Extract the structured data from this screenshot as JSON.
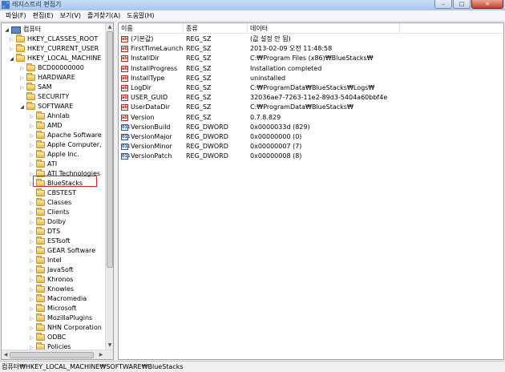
{
  "window": {
    "title": "레지스트리 편집기",
    "controls": {
      "minimize": "–",
      "maximize": "□",
      "close": "✕"
    }
  },
  "menu": [
    "파일(F)",
    "편집(E)",
    "보기(V)",
    "즐겨찾기(A)",
    "도움말(H)"
  ],
  "tree": {
    "items": [
      {
        "label": "컴퓨터",
        "level": 0,
        "expander": "open",
        "icon": "computer-icon"
      },
      {
        "label": "HKEY_CLASSES_ROOT",
        "level": 1,
        "expander": "closed",
        "icon": "folder-icon"
      },
      {
        "label": "HKEY_CURRENT_USER",
        "level": 1,
        "expander": "closed",
        "icon": "folder-icon"
      },
      {
        "label": "HKEY_LOCAL_MACHINE",
        "level": 1,
        "expander": "open",
        "icon": "folder-icon"
      },
      {
        "label": "BCD00000000",
        "level": 2,
        "expander": "closed",
        "icon": "folder-icon"
      },
      {
        "label": "HARDWARE",
        "level": 2,
        "expander": "closed",
        "icon": "folder-icon"
      },
      {
        "label": "SAM",
        "level": 2,
        "expander": "closed",
        "icon": "folder-icon"
      },
      {
        "label": "SECURITY",
        "level": 2,
        "expander": "none",
        "icon": "folder-icon"
      },
      {
        "label": "SOFTWARE",
        "level": 2,
        "expander": "open",
        "icon": "folder-icon"
      },
      {
        "label": "Ahnlab",
        "level": 3,
        "expander": "closed",
        "icon": "folder-icon"
      },
      {
        "label": "AMD",
        "level": 3,
        "expander": "closed",
        "icon": "folder-icon"
      },
      {
        "label": "Apache Software",
        "level": 3,
        "expander": "closed",
        "icon": "folder-icon"
      },
      {
        "label": "Apple Computer,",
        "level": 3,
        "expander": "closed",
        "icon": "folder-icon"
      },
      {
        "label": "Apple Inc.",
        "level": 3,
        "expander": "closed",
        "icon": "folder-icon"
      },
      {
        "label": "ATI",
        "level": 3,
        "expander": "closed",
        "icon": "folder-icon"
      },
      {
        "label": "ATI Technologies",
        "level": 3,
        "expander": "closed",
        "icon": "folder-icon"
      },
      {
        "label": "BlueStacks",
        "level": 3,
        "expander": "closed",
        "icon": "folder-icon",
        "selected": true
      },
      {
        "label": "CBSTEST",
        "level": 3,
        "expander": "none",
        "icon": "folder-icon"
      },
      {
        "label": "Classes",
        "level": 3,
        "expander": "closed",
        "icon": "folder-icon"
      },
      {
        "label": "Clients",
        "level": 3,
        "expander": "closed",
        "icon": "folder-icon"
      },
      {
        "label": "Dolby",
        "level": 3,
        "expander": "closed",
        "icon": "folder-icon"
      },
      {
        "label": "DTS",
        "level": 3,
        "expander": "closed",
        "icon": "folder-icon"
      },
      {
        "label": "ESTsoft",
        "level": 3,
        "expander": "closed",
        "icon": "folder-icon"
      },
      {
        "label": "GEAR Software",
        "level": 3,
        "expander": "closed",
        "icon": "folder-icon"
      },
      {
        "label": "Intel",
        "level": 3,
        "expander": "closed",
        "icon": "folder-icon"
      },
      {
        "label": "JavaSoft",
        "level": 3,
        "expander": "closed",
        "icon": "folder-icon"
      },
      {
        "label": "Khronos",
        "level": 3,
        "expander": "closed",
        "icon": "folder-icon"
      },
      {
        "label": "Knowles",
        "level": 3,
        "expander": "closed",
        "icon": "folder-icon"
      },
      {
        "label": "Macromedia",
        "level": 3,
        "expander": "closed",
        "icon": "folder-icon"
      },
      {
        "label": "Microsoft",
        "level": 3,
        "expander": "closed",
        "icon": "folder-icon"
      },
      {
        "label": "MozillaPlugins",
        "level": 3,
        "expander": "closed",
        "icon": "folder-icon"
      },
      {
        "label": "NHN Corporation",
        "level": 3,
        "expander": "closed",
        "icon": "folder-icon"
      },
      {
        "label": "ODBC",
        "level": 3,
        "expander": "closed",
        "icon": "folder-icon"
      },
      {
        "label": "Policies",
        "level": 3,
        "expander": "closed",
        "icon": "folder-icon"
      }
    ],
    "highlight_color": "#e0241c"
  },
  "values": {
    "columns": [
      "이름",
      "종류",
      "데이터"
    ],
    "rows": [
      {
        "name": "(기본값)",
        "type": "REG_SZ",
        "data": "(값 설정 안 됨)",
        "icon": "string-value-icon"
      },
      {
        "name": "FirstTimeLaunch",
        "type": "REG_SZ",
        "data": "2013-02-09 오전 11:48:58",
        "icon": "string-value-icon"
      },
      {
        "name": "InstallDir",
        "type": "REG_SZ",
        "data": "C:₩Program Files (x86)₩BlueStacks₩",
        "icon": "string-value-icon"
      },
      {
        "name": "InstallProgress",
        "type": "REG_SZ",
        "data": "Installation completed",
        "icon": "string-value-icon"
      },
      {
        "name": "InstallType",
        "type": "REG_SZ",
        "data": "uninstalled",
        "icon": "string-value-icon"
      },
      {
        "name": "LogDir",
        "type": "REG_SZ",
        "data": "C:₩ProgramData₩BlueStacks₩Logs₩",
        "icon": "string-value-icon"
      },
      {
        "name": "USER_GUID",
        "type": "REG_SZ",
        "data": "32036ae7-7263-11e2-89d3-5404a60bbf4e",
        "icon": "string-value-icon"
      },
      {
        "name": "UserDataDir",
        "type": "REG_SZ",
        "data": "C:₩ProgramData₩BlueStacks₩",
        "icon": "string-value-icon"
      },
      {
        "name": "Version",
        "type": "REG_SZ",
        "data": "0.7.8.829",
        "icon": "string-value-icon"
      },
      {
        "name": "VersionBuild",
        "type": "REG_DWORD",
        "data": "0x0000033d (829)",
        "icon": "dword-value-icon"
      },
      {
        "name": "VersionMajor",
        "type": "REG_DWORD",
        "data": "0x00000000 (0)",
        "icon": "dword-value-icon"
      },
      {
        "name": "VersionMinor",
        "type": "REG_DWORD",
        "data": "0x00000007 (7)",
        "icon": "dword-value-icon"
      },
      {
        "name": "VersionPatch",
        "type": "REG_DWORD",
        "data": "0x00000008 (8)",
        "icon": "dword-value-icon"
      }
    ]
  },
  "status": {
    "path": "컴퓨터₩HKEY_LOCAL_MACHINE₩SOFTWARE₩BlueStacks"
  }
}
